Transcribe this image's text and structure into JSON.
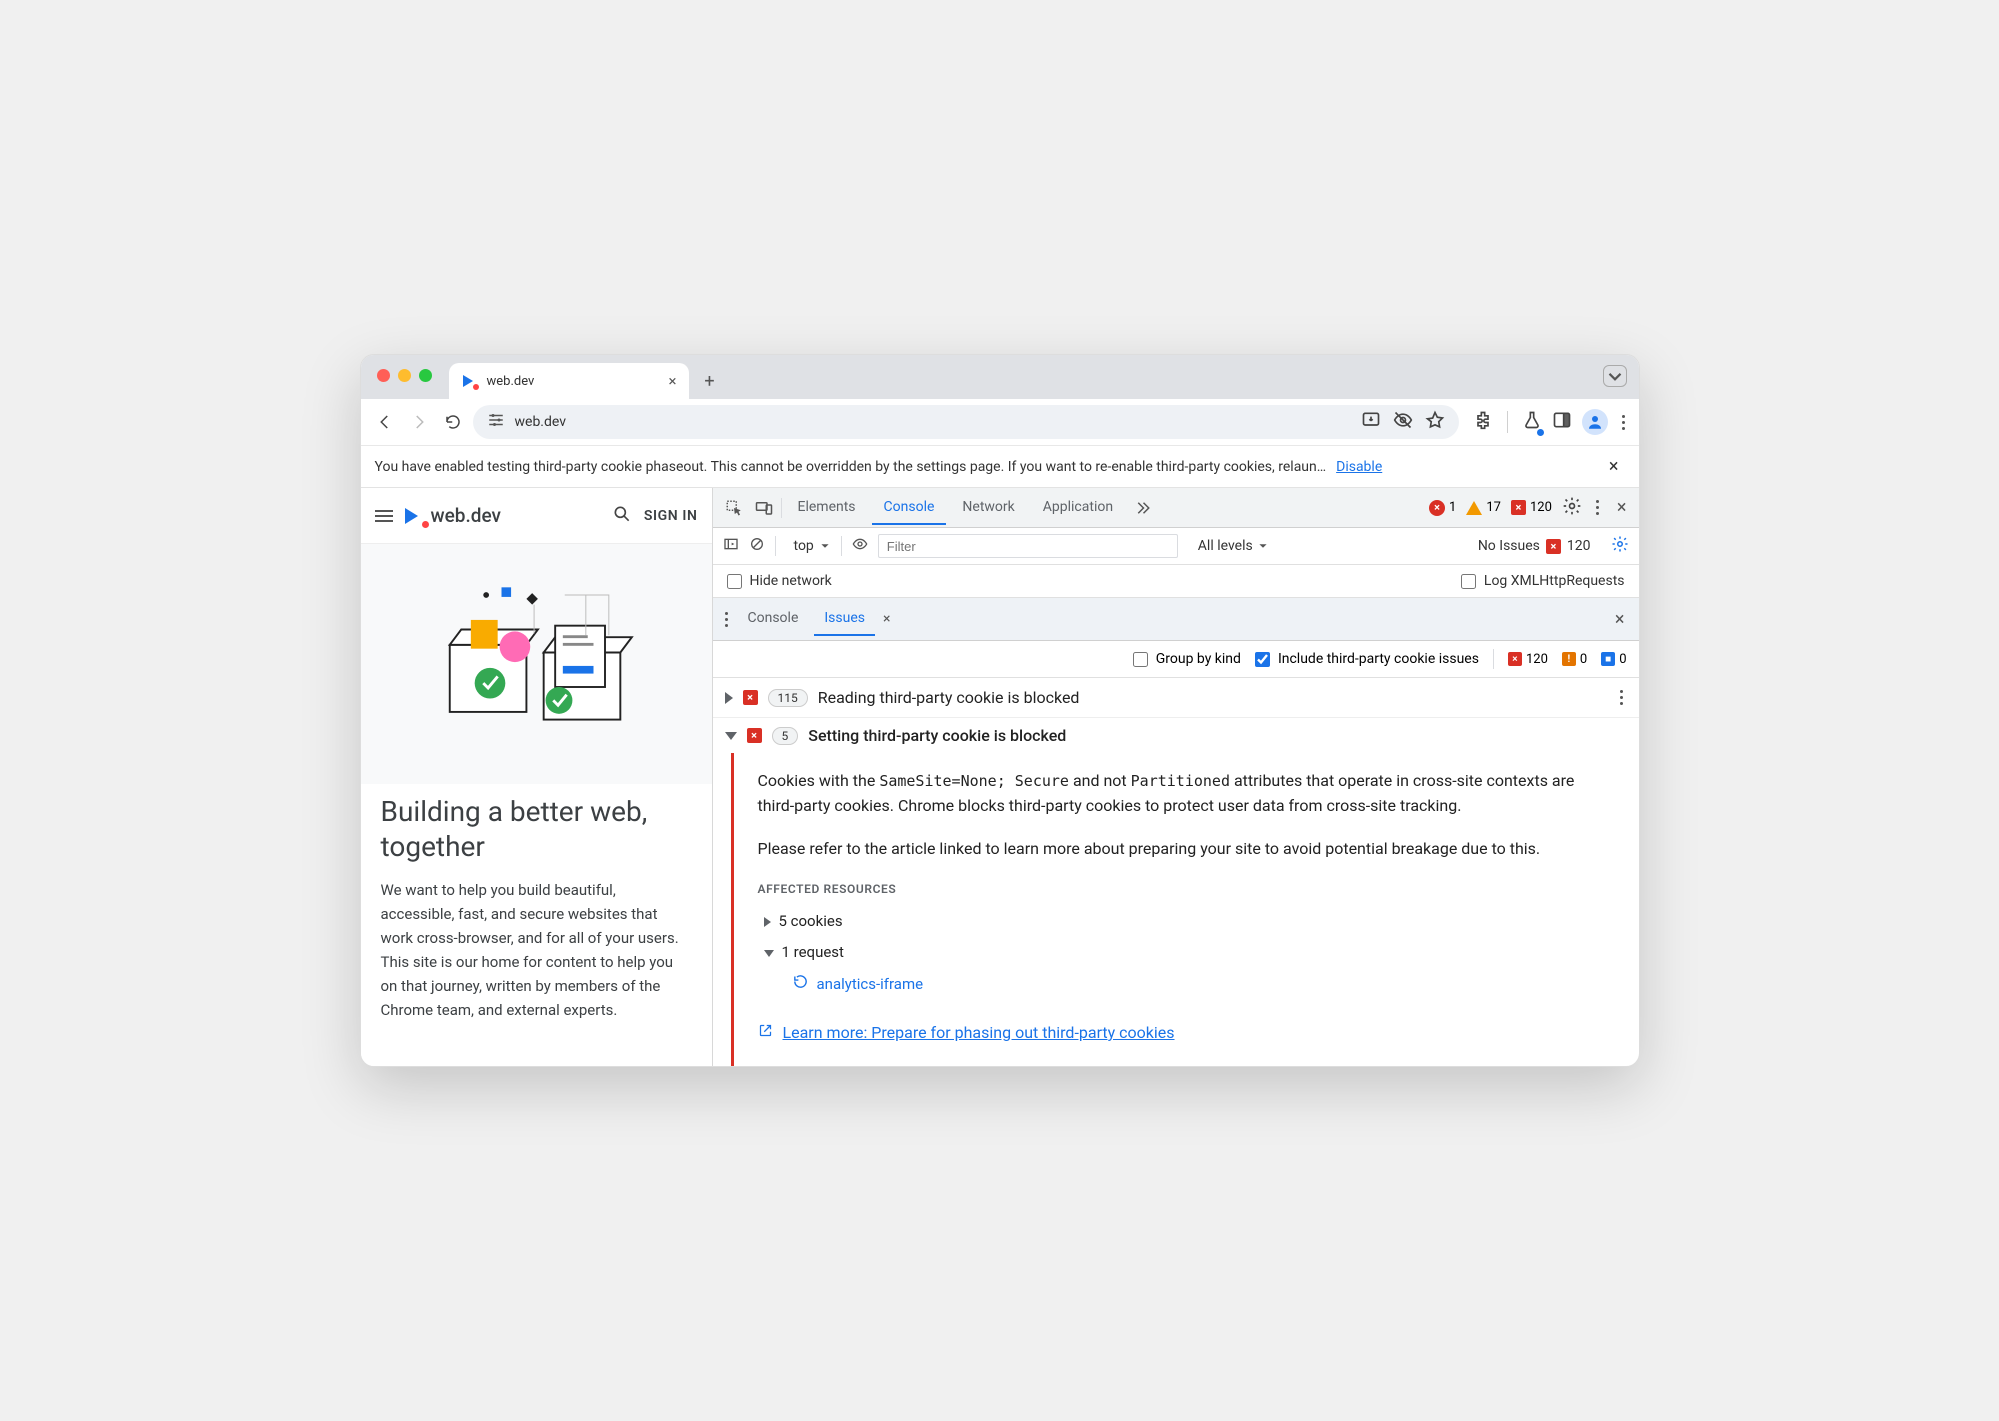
{
  "browser": {
    "tab_title": "web.dev",
    "url": "web.dev"
  },
  "banner": {
    "text": "You have enabled testing third-party cookie phaseout. This cannot be overridden by the settings page. If you want to re-enable third-party cookies, relaun…",
    "disable": "Disable"
  },
  "page": {
    "brand": "web.dev",
    "signin": "SIGN IN",
    "heading": "Building a better web, together",
    "body": "We want to help you build beautiful, accessible, fast, and secure websites that work cross-browser, and for all of your users. This site is our home for content to help you on that journey, written by members of the Chrome team, and external experts."
  },
  "devtools": {
    "tabs": {
      "elements": "Elements",
      "console": "Console",
      "network": "Network",
      "application": "Application"
    },
    "status": {
      "errors": "1",
      "warnings": "17",
      "issues": "120"
    },
    "console_tb": {
      "context": "top",
      "filter_placeholder": "Filter",
      "levels": "All levels",
      "no_issues": "No Issues",
      "no_issues_count": "120"
    },
    "console_opts": {
      "hide_network": "Hide network",
      "log_xhr": "Log XMLHttpRequests"
    },
    "drawer": {
      "console": "Console",
      "issues": "Issues"
    },
    "issues_tb": {
      "group": "Group by kind",
      "include3p": "Include third-party cookie issues",
      "c_err": "120",
      "c_warn": "0",
      "c_info": "0"
    },
    "issues": [
      {
        "count": "115",
        "title": "Reading third-party cookie is blocked"
      },
      {
        "count": "5",
        "title": "Setting third-party cookie is blocked"
      }
    ],
    "issue_detail": {
      "p1_a": "Cookies with the ",
      "p1_code": "SameSite=None; Secure",
      "p1_b": " and not ",
      "p1_code2": "Partitioned",
      "p1_c": " attributes that operate in cross-site contexts are third-party cookies. Chrome blocks third-party cookies to protect user data from cross-site tracking.",
      "p2": "Please refer to the article linked to learn more about preparing your site to avoid potential breakage due to this.",
      "aff_h": "AFFECTED RESOURCES",
      "cookies": "5 cookies",
      "requests": "1 request",
      "req1": "analytics-iframe",
      "learn": "Learn more: Prepare for phasing out third-party cookies"
    }
  }
}
